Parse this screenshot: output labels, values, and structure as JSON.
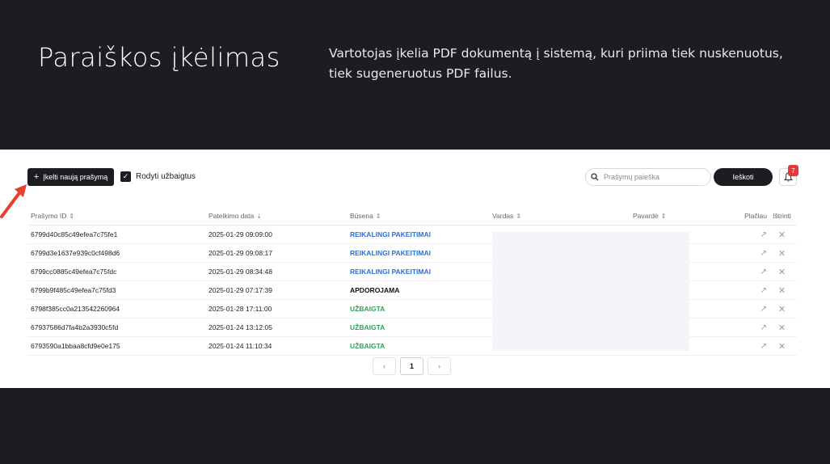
{
  "slide": {
    "title": "Paraiškos įkėlimas",
    "description": "Vartotojas įkelia PDF dokumentą į sistemą, kuri priima tiek nuskenuotus, tiek sugeneruotus PDF failus."
  },
  "toolbar": {
    "upload_label": "Įkelti naują prašymą",
    "upload_icon": "+",
    "show_completed_label": "Rodyti užbaigtus",
    "show_completed_checked": true,
    "search_placeholder": "Prašymų paieška",
    "search_button": "Ieškoti",
    "notification_count": "7"
  },
  "table": {
    "headers": {
      "id": "Prašymo ID",
      "date": "Pateikimo data",
      "status": "Būsena",
      "name": "Vardas",
      "surname": "Pavardė",
      "more": "Plačiau",
      "delete": "Ištrinti"
    },
    "rows": [
      {
        "id": "6799d40c85c49efea7c75fe1",
        "date": "2025-01-29 09:09:00",
        "status": "REIKALINGI PAKEITIMAI",
        "status_color": "#2f6fd6"
      },
      {
        "id": "6799d3e1637e939c0cf498d6",
        "date": "2025-01-29 09:08:17",
        "status": "REIKALINGI PAKEITIMAI",
        "status_color": "#2f6fd6"
      },
      {
        "id": "6799cc0885c49efea7c75fdc",
        "date": "2025-01-29 08:34:48",
        "status": "REIKALINGI PAKEITIMAI",
        "status_color": "#2f6fd6"
      },
      {
        "id": "6799b9f485c49efea7c75fd3",
        "date": "2025-01-29 07:17:39",
        "status": "APDOROJAMA",
        "status_color": "#111111"
      },
      {
        "id": "6798f385cc0a213542260964",
        "date": "2025-01-28 17:11:00",
        "status": "UŽBAIGTA",
        "status_color": "#2fa55b"
      },
      {
        "id": "67937586d7fa4b2a3930c5fd",
        "date": "2025-01-24 13:12:05",
        "status": "UŽBAIGTA",
        "status_color": "#2fa55b"
      },
      {
        "id": "6793590a1bbaa8cfd9e0e175",
        "date": "2025-01-24 11:10:34",
        "status": "UŽBAIGTA",
        "status_color": "#2fa55b"
      }
    ]
  },
  "pagination": {
    "prev": "‹",
    "current": "1",
    "next": "›"
  },
  "icons": {
    "more": "more-arrow-icon",
    "delete": "close-icon",
    "bell": "bell-icon",
    "search": "search-icon",
    "check": "check-icon"
  }
}
